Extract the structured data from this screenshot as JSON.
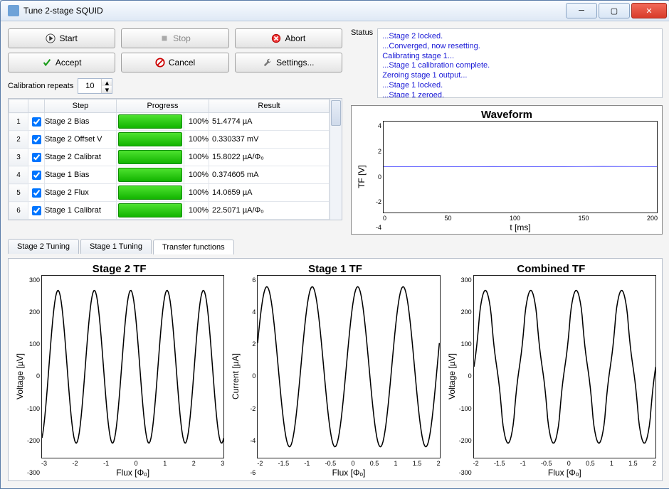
{
  "window": {
    "title": "Tune 2-stage SQUID"
  },
  "buttons": {
    "start": "Start",
    "stop": "Stop",
    "abort": "Abort",
    "accept": "Accept",
    "cancel": "Cancel",
    "settings": "Settings..."
  },
  "cal_repeats": {
    "label": "Calibration repeats",
    "value": "10"
  },
  "table": {
    "headers": {
      "step": "Step",
      "progress": "Progress",
      "result": "Result"
    },
    "rows": [
      {
        "n": "1",
        "checked": true,
        "step": "Stage 2 Bias",
        "pct": "100%",
        "result": "51.4774 µA"
      },
      {
        "n": "2",
        "checked": true,
        "step": "Stage 2 Offset V",
        "pct": "100%",
        "result": "0.330337 mV"
      },
      {
        "n": "3",
        "checked": true,
        "step": "Stage 2 Calibrat",
        "pct": "100%",
        "result": "15.8022 µA/Φₒ"
      },
      {
        "n": "4",
        "checked": true,
        "step": "Stage 1 Bias",
        "pct": "100%",
        "result": "0.374605 mA"
      },
      {
        "n": "5",
        "checked": true,
        "step": "Stage 2 Flux",
        "pct": "100%",
        "result": "14.0659 µA"
      },
      {
        "n": "6",
        "checked": true,
        "step": "Stage 1 Calibrat",
        "pct": "100%",
        "result": "22.5071 µA/Φₒ"
      }
    ]
  },
  "status": {
    "label": "Status",
    "lines": [
      "...Stage 2 locked.",
      "...Converged, now resetting.",
      "Calibrating stage 1...",
      "...Stage 1 calibration complete.",
      "Zeroing stage 1 output...",
      "...Stage 1 locked.",
      "...Stage 1 zeroed."
    ]
  },
  "waveform": {
    "title": "Waveform",
    "ylabel": "TF [V]",
    "xlabel": "t [ms]",
    "yticks": [
      "4",
      "2",
      "0",
      "-2",
      "-4"
    ],
    "xticks": [
      "0",
      "50",
      "100",
      "150",
      "200"
    ]
  },
  "tabs": {
    "t1": "Stage 2 Tuning",
    "t2": "Stage 1 Tuning",
    "t3": "Transfer functions"
  },
  "tf": {
    "s2": {
      "title": "Stage 2 TF",
      "ylabel": "Voltage [µV]",
      "xlabel": "Flux [Φₒ]",
      "yticks": [
        "300",
        "200",
        "100",
        "0",
        "-100",
        "-200",
        "-300"
      ],
      "xticks": [
        "-3",
        "-2",
        "-1",
        "0",
        "1",
        "2",
        "3"
      ]
    },
    "s1": {
      "title": "Stage 1 TF",
      "ylabel": "Current [µA]",
      "xlabel": "Flux [Φₒ]",
      "yticks": [
        "6",
        "4",
        "2",
        "0",
        "-2",
        "-4",
        "-6"
      ],
      "xticks": [
        "-2",
        "-1.5",
        "-1",
        "-0.5",
        "0",
        "0.5",
        "1",
        "1.5",
        "2"
      ]
    },
    "cb": {
      "title": "Combined TF",
      "ylabel": "Voltage [µV]",
      "xlabel": "Flux [Φₒ]",
      "yticks": [
        "300",
        "200",
        "100",
        "0",
        "-100",
        "-200",
        "-300"
      ],
      "xticks": [
        "-2",
        "-1.5",
        "-1",
        "-0.5",
        "0",
        "0.5",
        "1",
        "1.5",
        "2"
      ]
    }
  },
  "chart_data": [
    {
      "type": "line",
      "title": "Waveform",
      "xlabel": "t [ms]",
      "ylabel": "TF [V]",
      "xlim": [
        0,
        200
      ],
      "ylim": [
        -5,
        5
      ],
      "x": [
        0,
        50,
        100,
        150,
        200
      ],
      "values": [
        0.05,
        0.03,
        0.05,
        0.04,
        0.06
      ]
    },
    {
      "type": "line",
      "title": "Stage 2 TF",
      "xlabel": "Flux [Φₒ]",
      "ylabel": "Voltage [µV]",
      "xlim": [
        -3,
        3
      ],
      "ylim": [
        -300,
        300
      ],
      "periods": 5,
      "amplitude": 265,
      "note": "sinusoid, ~5 periods across -2.5..2.5 Φₒ, peaks ≈ +265/−280 µV"
    },
    {
      "type": "line",
      "title": "Stage 1 TF",
      "xlabel": "Flux [Φₒ]",
      "ylabel": "Current [µA]",
      "xlim": [
        -2,
        2
      ],
      "ylim": [
        -6,
        6
      ],
      "periods": 4,
      "amplitude": 5.4,
      "note": "triangular/sinusoid, ~4 periods across -2..2 Φₒ, peaks ≈ ±5.4 µA"
    },
    {
      "type": "line",
      "title": "Combined TF",
      "xlabel": "Flux [Φₒ]",
      "ylabel": "Voltage [µV]",
      "xlim": [
        -2,
        2
      ],
      "ylim": [
        -300,
        300
      ],
      "periods": 4,
      "amplitude": 260,
      "note": "double-peaked lobes repeating ~every 1 Φₒ, peaks ≈ +260/−290 µV"
    }
  ]
}
